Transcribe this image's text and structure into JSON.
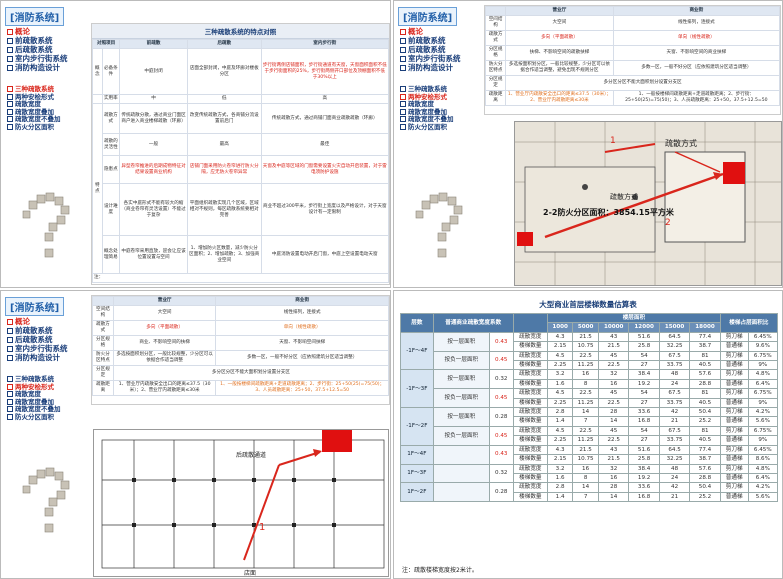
{
  "sidebar": {
    "title": "[消防系统]",
    "items_top": [
      "概论",
      "前疏散系统",
      "后疏散系统",
      "室内步行街系统",
      "消防构造设计"
    ],
    "items_bottom": [
      "三种疏散系统",
      "两种安检形式",
      "疏散宽度",
      "疏散宽度叠加",
      "疏散宽度不叠加",
      "防火分区面积"
    ]
  },
  "slide1": {
    "doc_title": "三种疏散系统的特点对照",
    "headers": [
      "对照项目",
      "前疏散",
      "后疏散",
      "室内步行街"
    ],
    "rows": [
      [
        "概念",
        "必备条件",
        "中庭封闭",
        "店面全部封闭，中庭及环廊对楼板分区",
        "步行街两侧店铺面积，步行街通道有天窗，天窗面积面积不低于步行街面积的25%，步行街两侧开口部位及顶棚面积不低于30%以上"
      ],
      [
        "",
        "实用率",
        "中",
        "低",
        "高"
      ],
      [
        "特点",
        "疏散方式",
        "传统疏散分散，通过商业门面区商户进入商业楼梯疏散（环廊）",
        "改变传统疏散方式，各商铺分流设置前后门",
        "传统疏散方式，通过商铺门面商业疏散疏散（环廊）"
      ],
      [
        "",
        "疏散的灵活性",
        "一般",
        "最高",
        "最佳"
      ],
      [
        "",
        "隐患点",
        "异型卷帘推进的后期成物特征对结果设置商业机构",
        "店铺门面采用防火卷帘进行防火分隔，应无防火卷帘异常",
        "天窗及中庭等区域的门窗需要设置火灾自动开启装置，对于雷电须防护设施"
      ],
      [
        "",
        "设计难度",
        "各实中庭形式不能有较大的缩（商业卷帘有灵活设置）不能过于复杂",
        "平面组织疏散实现几个区域，区域相对不规则，每区疏散系统要相对完善",
        "商业不超过300平米，步行街上宽度以及严格设计，对于天窗设计有一定限制"
      ],
      [
        "",
        "概念处理简易",
        "中庭卷帘采用直放，迎会让应该位置设置与空间",
        "1、增加防火区数量，减少防火分区面积；2、增加疏散；3、加强商业空间",
        "中庭消防设置电动开启门窗，中庭上空设置电动天窗"
      ]
    ],
    "footer": "注："
  },
  "slide2": {
    "headers": [
      "",
      "营业厅",
      "商业街"
    ],
    "rows": [
      [
        "空间结构",
        "大空间",
        "线性排列，连接式"
      ],
      [
        "疏散方式",
        "多向（平面疏散）",
        "单向（线性疏散）"
      ],
      [
        "分区规格",
        "扶梯、不影响空间的疏散扶梯",
        "天窗、不影响空间的商业扶梯"
      ],
      [
        "防火分区特点",
        "多选按面积划分区，一般比较规整，少分区可以依据合作适当调整，避免出现不规则分区",
        "多数一区，一般不好分区（应依照建筑分区适当调整）"
      ],
      [
        "分区规定",
        "多分区分区不能大面积划分设置分支区",
        ""
      ],
      [
        "疏散距离",
        "1、营业厅内疏散安全出口的距离≤37.5（30米）；2、营业厅内疏散距离≤30米",
        "1、一般按楼梯间疏散距离+走道疏散距离；2、步行街：25+50(25)=75(50)；3、人员疏散距离：25+50，37.5+12.5=50"
      ]
    ],
    "plan_label1": "疏散方式",
    "plan_label2": "疏散方式",
    "plan_label3": "2-2防火分区面积：3854.15平方米",
    "plan_num1": "1",
    "plan_num2": "2"
  },
  "slide3": {
    "headers": [
      "",
      "营业厅",
      "商业街"
    ],
    "rows": [
      [
        "空间结构",
        "大空间",
        "线性排列，连接式"
      ],
      [
        "疏散方式",
        "多向（平面疏散）",
        "单向（线性疏散）"
      ],
      [
        "分区规格",
        "商业、不影响空间的扶梯",
        "天窗、不影响空间扶梯"
      ],
      [
        "防火分区特点",
        "多选按面积划分区，一般比较规整，少分区可以依据合作适当调整",
        "多数一区，一般不好分区（应依照建筑分区适当调整）"
      ],
      [
        "分区规定",
        "多分区分区不能大面积划分设置分支区",
        ""
      ],
      [
        "疏散距离",
        "1、营业厅内疏散安全出口的距离≤37.5（30米）；2、营业厅内疏散距离≤30米",
        "1、一般按楼梯间疏散距离+走道疏散距离；2、步行街：25+50(25)=75(50)；3、人员疏散距离：25+50，37.5+12.5=50"
      ]
    ],
    "plan_label": "后疏散通道",
    "plan_num": "1",
    "plan_bottom": "店面"
  },
  "slide4": {
    "title": "大型商业首层楼梯数量估算表",
    "col_floor": "层数",
    "col_coef": "普通商业疏散宽度系数",
    "col_group": "楼层面积",
    "areas": [
      "1000",
      "5000",
      "10000",
      "12000",
      "15000",
      "18000"
    ],
    "col_type": "楼梯占层面积比",
    "rows": [
      [
        "-1F～4F",
        "按一层面积",
        "0.43",
        "疏散宽度",
        "4.3",
        "21.5",
        "43",
        "51.6",
        "64.5",
        "77.4",
        "剪刀梯",
        "6.45%"
      ],
      [
        "",
        "",
        "",
        "楼梯数量",
        "2.15",
        "10.75",
        "21.5",
        "25.8",
        "32.25",
        "38.7",
        "普通梯",
        "9.6%"
      ],
      [
        "",
        "按负一层面积",
        "0.45",
        "疏散宽度",
        "4.5",
        "22.5",
        "45",
        "54",
        "67.5",
        "81",
        "剪刀梯",
        "6.75%"
      ],
      [
        "",
        "",
        "",
        "楼梯数量",
        "2.25",
        "11.25",
        "22.5",
        "27",
        "33.75",
        "40.5",
        "普通梯",
        "9%"
      ],
      [
        "-1F～3F",
        "按一层面积",
        "0.32",
        "疏散宽度",
        "3.2",
        "16",
        "32",
        "38.4",
        "48",
        "57.6",
        "剪刀梯",
        "4.8%"
      ],
      [
        "",
        "",
        "",
        "楼梯数量",
        "1.6",
        "8",
        "16",
        "19.2",
        "24",
        "28.8",
        "普通梯",
        "6.4%"
      ],
      [
        "",
        "按负一层面积",
        "0.45",
        "疏散宽度",
        "4.5",
        "22.5",
        "45",
        "54",
        "67.5",
        "81",
        "剪刀梯",
        "6.75%"
      ],
      [
        "",
        "",
        "",
        "楼梯数量",
        "2.25",
        "11.25",
        "22.5",
        "27",
        "33.75",
        "40.5",
        "普通梯",
        "9%"
      ],
      [
        "-1F～2F",
        "按一层面积",
        "0.28",
        "疏散宽度",
        "2.8",
        "14",
        "28",
        "33.6",
        "42",
        "50.4",
        "剪刀梯",
        "4.2%"
      ],
      [
        "",
        "",
        "",
        "楼梯数量",
        "1.4",
        "7",
        "14",
        "16.8",
        "21",
        "25.2",
        "普通梯",
        "5.6%"
      ],
      [
        "",
        "按负一层面积",
        "0.45",
        "疏散宽度",
        "4.5",
        "22.5",
        "45",
        "54",
        "67.5",
        "81",
        "剪刀梯",
        "6.75%"
      ],
      [
        "",
        "",
        "",
        "楼梯数量",
        "2.25",
        "11.25",
        "22.5",
        "27",
        "33.75",
        "40.5",
        "普通梯",
        "9%"
      ],
      [
        "1F～4F",
        "",
        "0.43",
        "疏散宽度",
        "4.3",
        "21.5",
        "43",
        "51.6",
        "64.5",
        "77.4",
        "剪刀梯",
        "6.45%"
      ],
      [
        "",
        "",
        "",
        "楼梯数量",
        "2.15",
        "10.75",
        "21.5",
        "25.8",
        "32.25",
        "38.7",
        "普通梯",
        "8.6%"
      ],
      [
        "1F～3F",
        "",
        "0.32",
        "疏散宽度",
        "3.2",
        "16",
        "32",
        "38.4",
        "48",
        "57.6",
        "剪刀梯",
        "4.8%"
      ],
      [
        "",
        "",
        "",
        "楼梯数量",
        "1.6",
        "8",
        "16",
        "19.2",
        "24",
        "28.8",
        "普通梯",
        "6.4%"
      ],
      [
        "1F～2F",
        "",
        "0.28",
        "疏散宽度",
        "2.8",
        "14",
        "28",
        "33.6",
        "42",
        "50.4",
        "剪刀梯",
        "4.2%"
      ],
      [
        "",
        "",
        "",
        "楼梯数量",
        "1.4",
        "7",
        "14",
        "16.8",
        "21",
        "25.2",
        "普通梯",
        "5.6%"
      ]
    ],
    "note": "注：疏散楼梯宽度按2米计。"
  }
}
